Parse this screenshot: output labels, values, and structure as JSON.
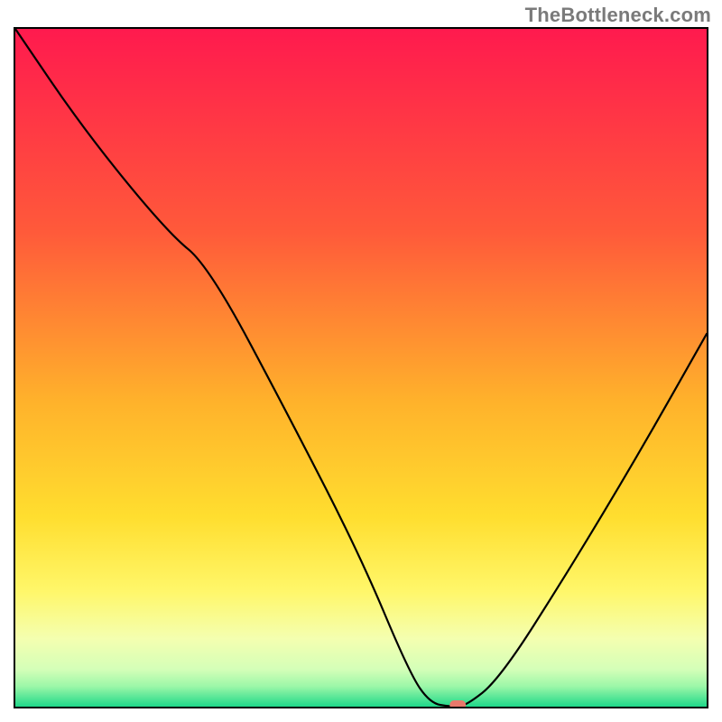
{
  "watermark": "TheBottleneck.com",
  "chart_data": {
    "type": "line",
    "title": "",
    "xlabel": "",
    "ylabel": "",
    "xlim": [
      0,
      100
    ],
    "ylim": [
      0,
      100
    ],
    "series": [
      {
        "name": "curve",
        "x": [
          0,
          10,
          22,
          28,
          40,
          50,
          57,
          60,
          63,
          65,
          70,
          80,
          90,
          100
        ],
        "values": [
          100,
          85,
          70,
          65,
          42,
          22,
          5,
          0.5,
          0,
          0,
          4,
          20,
          37,
          55
        ]
      }
    ],
    "marker": {
      "x": 64,
      "y": 0
    },
    "gradient_stops": [
      {
        "offset": 0.0,
        "color": "#ff1a4e"
      },
      {
        "offset": 0.3,
        "color": "#ff5a3a"
      },
      {
        "offset": 0.55,
        "color": "#ffb22b"
      },
      {
        "offset": 0.72,
        "color": "#ffde2f"
      },
      {
        "offset": 0.83,
        "color": "#fff76a"
      },
      {
        "offset": 0.9,
        "color": "#f4ffb0"
      },
      {
        "offset": 0.945,
        "color": "#d4ffb8"
      },
      {
        "offset": 0.97,
        "color": "#9cf7a8"
      },
      {
        "offset": 1.0,
        "color": "#1fd88a"
      }
    ]
  }
}
